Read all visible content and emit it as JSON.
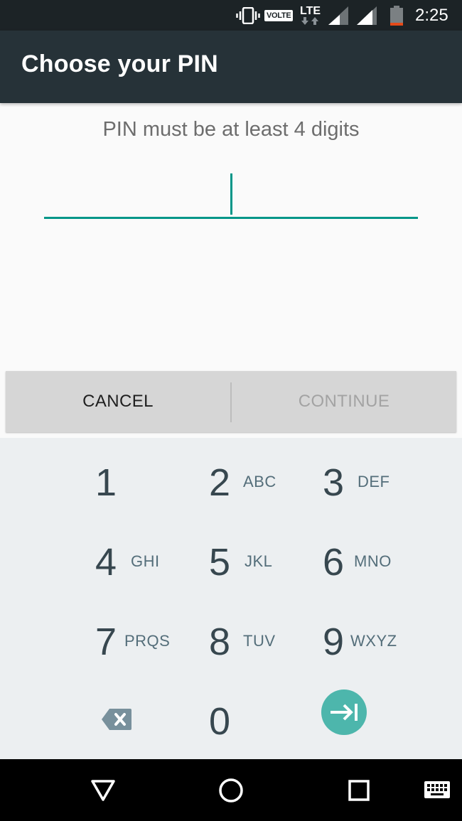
{
  "status_bar": {
    "icons": [
      "vibrate-icon",
      "volte-badge",
      "lte-data-icon",
      "signal-icon",
      "signal-icon",
      "battery-low-icon"
    ],
    "volte_label": "VOLTE",
    "network_label": "LTE",
    "time": "2:25",
    "battery_accent": "#e64a19"
  },
  "app_bar": {
    "title": "Choose your PIN",
    "color": "#263238"
  },
  "pin_entry": {
    "prompt": "PIN must be at least 4 digits",
    "value": "",
    "accent_color": "#009688"
  },
  "buttons": {
    "cancel_label": "CANCEL",
    "continue_label": "CONTINUE"
  },
  "keypad": {
    "keys": [
      {
        "digit": "1",
        "letters": ""
      },
      {
        "digit": "2",
        "letters": "ABC"
      },
      {
        "digit": "3",
        "letters": "DEF"
      },
      {
        "digit": "4",
        "letters": "GHI"
      },
      {
        "digit": "5",
        "letters": "JKL"
      },
      {
        "digit": "6",
        "letters": "MNO"
      },
      {
        "digit": "7",
        "letters": "PRQS"
      },
      {
        "digit": "8",
        "letters": "TUV"
      },
      {
        "digit": "9",
        "letters": "WXYZ"
      },
      {
        "digit": "0",
        "letters": ""
      }
    ],
    "delete_icon": "backspace-icon",
    "enter_icon": "tab-enter-icon",
    "enter_color": "#4db6ac"
  },
  "nav_bar": {
    "icons": [
      "back-triangle-icon",
      "home-circle-icon",
      "recents-square-icon",
      "keyboard-icon"
    ]
  }
}
